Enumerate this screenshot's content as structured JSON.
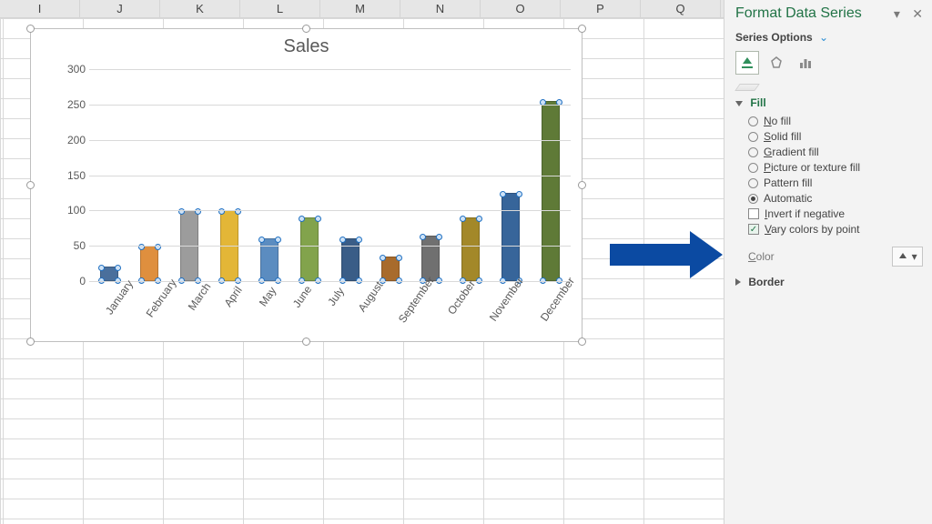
{
  "columns": [
    "I",
    "J",
    "K",
    "L",
    "M",
    "N",
    "O",
    "P",
    "Q"
  ],
  "pane": {
    "title": "Format Data Series",
    "series_options_label": "Series Options",
    "fill_label": "Fill",
    "border_label": "Border",
    "radios": {
      "no_fill": "No fill",
      "solid": "Solid fill",
      "gradient": "Gradient fill",
      "picture": "Picture or texture fill",
      "pattern": "Pattern fill",
      "automatic": "Automatic"
    },
    "checks": {
      "invert": "Invert if negative",
      "vary": "Vary colors by point"
    },
    "color_label": "Color",
    "selected_radio": "automatic",
    "vary_checked": true,
    "invert_checked": false
  },
  "chart_data": {
    "type": "bar",
    "title": "Sales",
    "xlabel": "",
    "ylabel": "",
    "ylim": [
      0,
      300
    ],
    "ytick_step": 50,
    "categories": [
      "January",
      "February",
      "March",
      "April",
      "May",
      "June",
      "July",
      "August",
      "September",
      "October",
      "November",
      "December"
    ],
    "values": [
      20,
      50,
      100,
      100,
      60,
      90,
      60,
      35,
      65,
      90,
      125,
      255
    ],
    "colors": [
      "#4a6f9c",
      "#df8f3e",
      "#9c9c9c",
      "#e3b637",
      "#5b8cc0",
      "#82a34c",
      "#3a5d87",
      "#a86b2c",
      "#707070",
      "#a38829",
      "#37659a",
      "#5f7a37"
    ]
  }
}
